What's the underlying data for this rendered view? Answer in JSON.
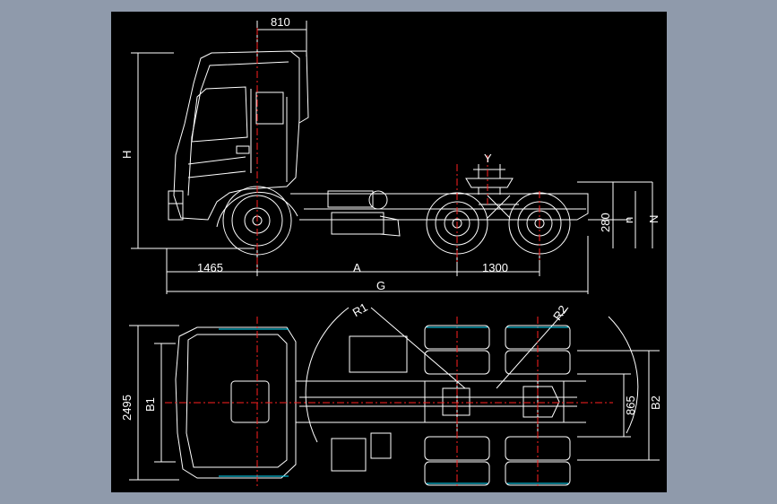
{
  "colors": {
    "viewer_bg": "#8f9aab",
    "sheet_bg": "#000000",
    "line": "#ffffff",
    "centerline": "#ff2020",
    "accent": "#00e0ff"
  },
  "side_view": {
    "dim_cab_overhang": "810",
    "dim_height_H": "H",
    "dim_front": "1465",
    "dim_wheelbase_A": "A",
    "dim_rear_axles": "1300",
    "dim_length_G": "G",
    "dim_fifth_wheel_Y": "Y",
    "dim_frame_280": "280",
    "dim_n": "n",
    "dim_N": "N"
  },
  "top_view": {
    "dim_radius_R1": "R1",
    "dim_radius_R2": "R2",
    "dim_width_2495": "2495",
    "dim_width_B1": "B1",
    "dim_track_865": "865",
    "dim_width_B2": "B2"
  }
}
